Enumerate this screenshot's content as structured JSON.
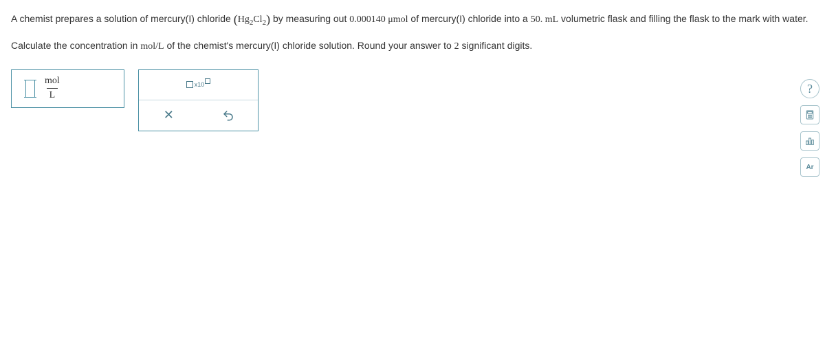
{
  "problem": {
    "line1_a": "A chemist prepares a solution of mercury(I) chloride ",
    "formula_open": "(",
    "formula_hg": "Hg",
    "formula_sub1": "2",
    "formula_cl": "Cl",
    "formula_sub2": "2",
    "formula_close": ")",
    "line1_b": " by measuring out ",
    "amount": "0.000140 μmol",
    "line1_c": " of mercury(I) chloride into a ",
    "volume": "50. mL",
    "line1_d": " volumetric flask and filling the flask to the mark with water.",
    "line2_a": "Calculate the concentration in ",
    "unit_molL": "mol/L",
    "line2_b": " of the chemist's mercury(I) chloride solution. Round your answer to ",
    "sigfigs": "2",
    "line2_c": " significant digits."
  },
  "answer": {
    "unit_num": "mol",
    "unit_den": "L"
  },
  "tools": {
    "sci_x10": "x10",
    "clear": "✕",
    "help": "?",
    "ar": "Ar"
  }
}
